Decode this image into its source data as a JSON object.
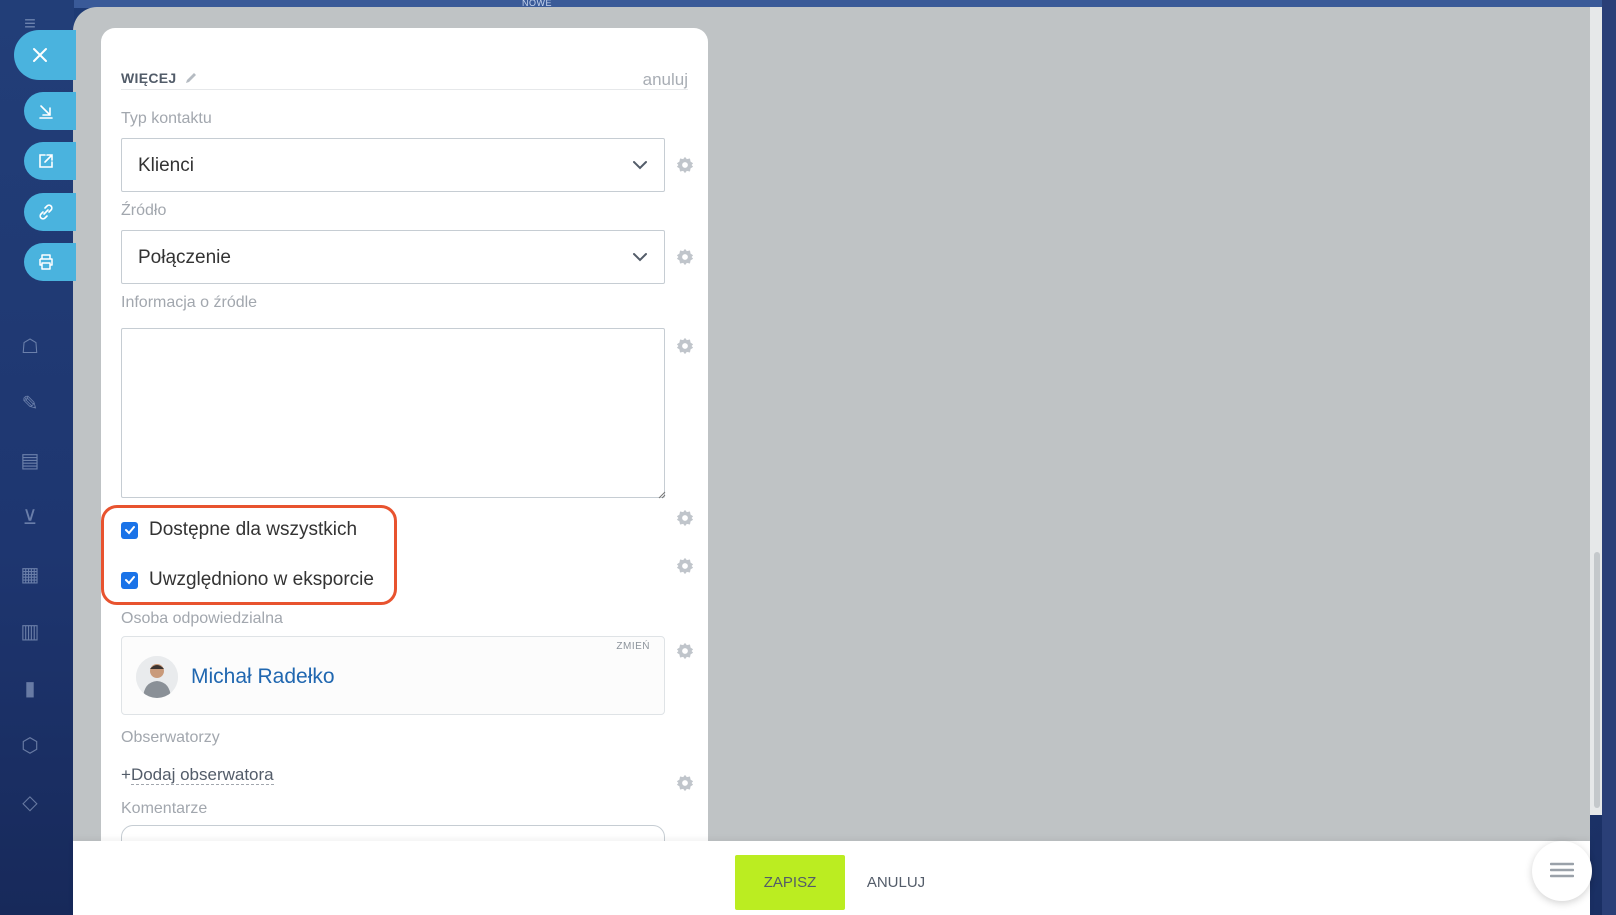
{
  "top_strip": {
    "label": "NOWE"
  },
  "card": {
    "title": "WIĘCEJ",
    "cancel_label": "anuluj"
  },
  "fields": {
    "contact_type": {
      "label": "Typ kontaktu",
      "value": "Klienci"
    },
    "source": {
      "label": "Źródło",
      "value": "Połączenie"
    },
    "source_info": {
      "label": "Informacja o źródle",
      "value": ""
    },
    "available_to_all": {
      "label": "Dostępne dla wszystkich",
      "checked": true
    },
    "included_in_export": {
      "label": "Uwzględniono w eksporcie",
      "checked": true
    },
    "responsible": {
      "label": "Osoba odpowiedzialna",
      "name": "Michał Radełko",
      "change_label": "ZMIEŃ"
    },
    "observers": {
      "label": "Obserwatorzy",
      "add_prefix": "+",
      "add_label": "Dodaj obserwatora"
    },
    "comments": {
      "label": "Komentarze"
    }
  },
  "footer": {
    "save_label": "ZAPISZ",
    "cancel_label": "ANULUJ"
  },
  "colors": {
    "accent": "#4ab3de",
    "save": "#bbed21",
    "highlight": "#e8532f",
    "link": "#2067b0",
    "checkbox": "#1a73e8"
  }
}
